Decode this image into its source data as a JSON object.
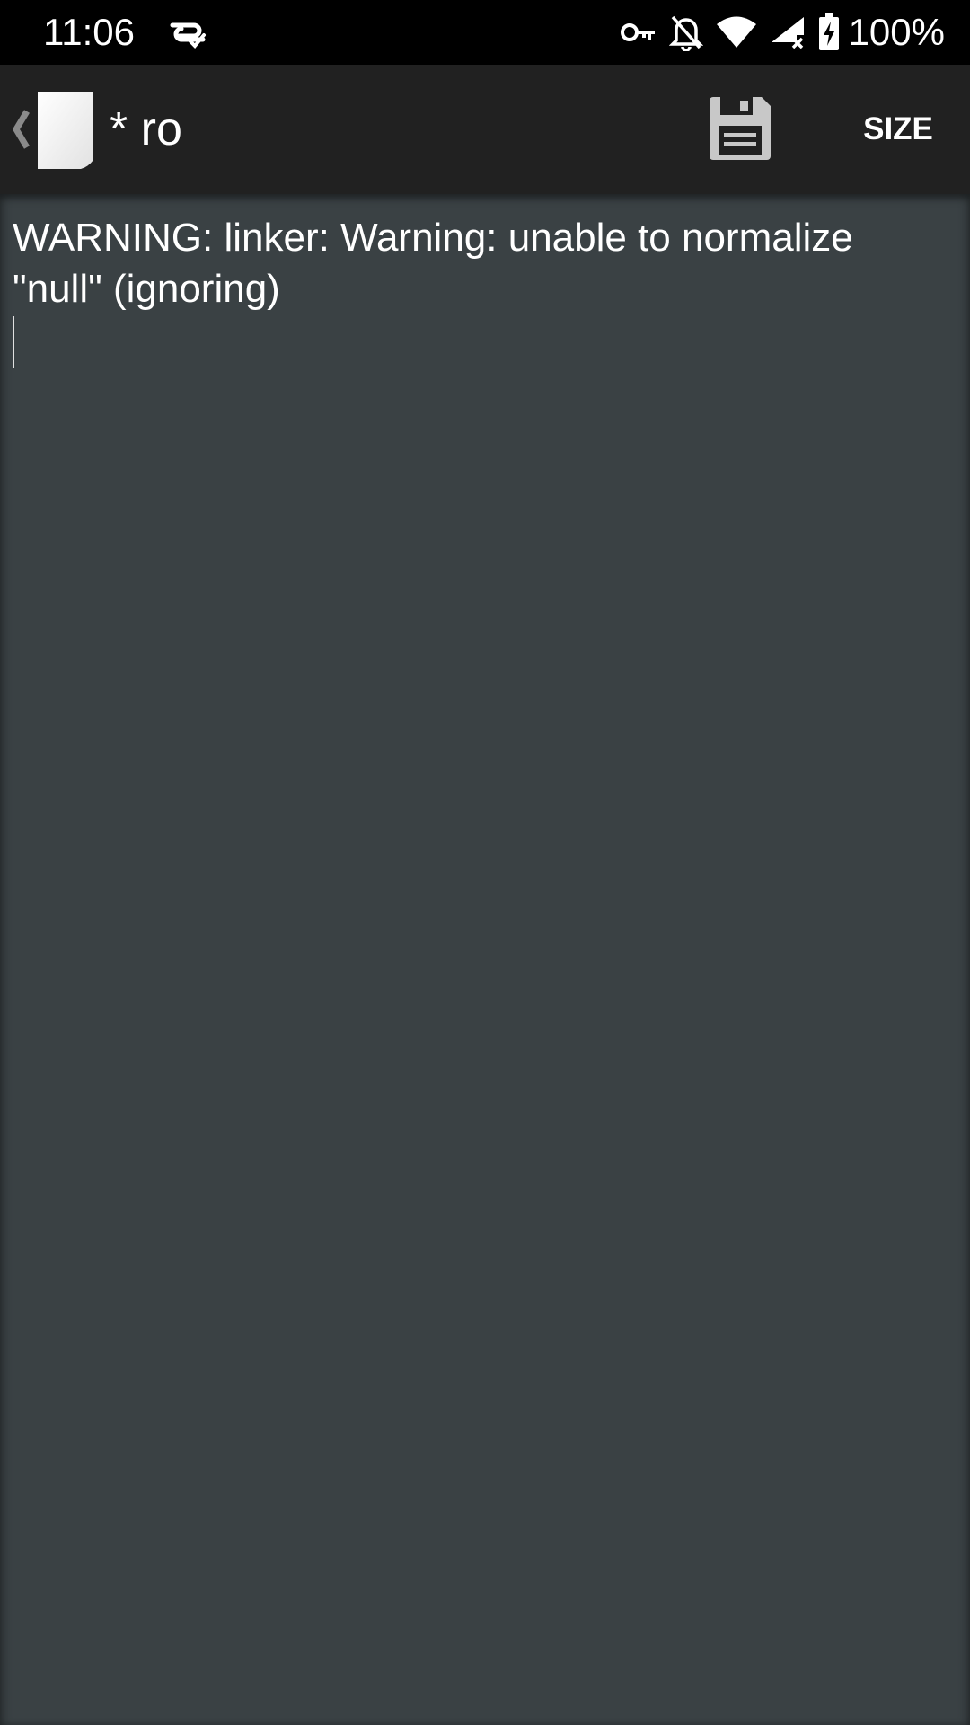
{
  "status_bar": {
    "time": "11:06",
    "battery_percent": "100%",
    "icons": [
      "app-sync-icon",
      "vpn-key-icon",
      "notifications-off-icon",
      "wifi-icon",
      "cell-signal-icon",
      "battery-charging-icon"
    ]
  },
  "app_bar": {
    "title": "* ro",
    "size_label": "SIZE",
    "icons": [
      "back-chevron-icon",
      "document-icon",
      "save-icon"
    ]
  },
  "editor": {
    "content_line1": "WARNING: linker: Warning: unable to normalize",
    "content_line2": "\"null\" (ignoring)"
  },
  "colors": {
    "status_bar_bg": "#000000",
    "app_bar_bg": "#212121",
    "editor_bg": "#3a4144",
    "text": "#ffffff"
  }
}
